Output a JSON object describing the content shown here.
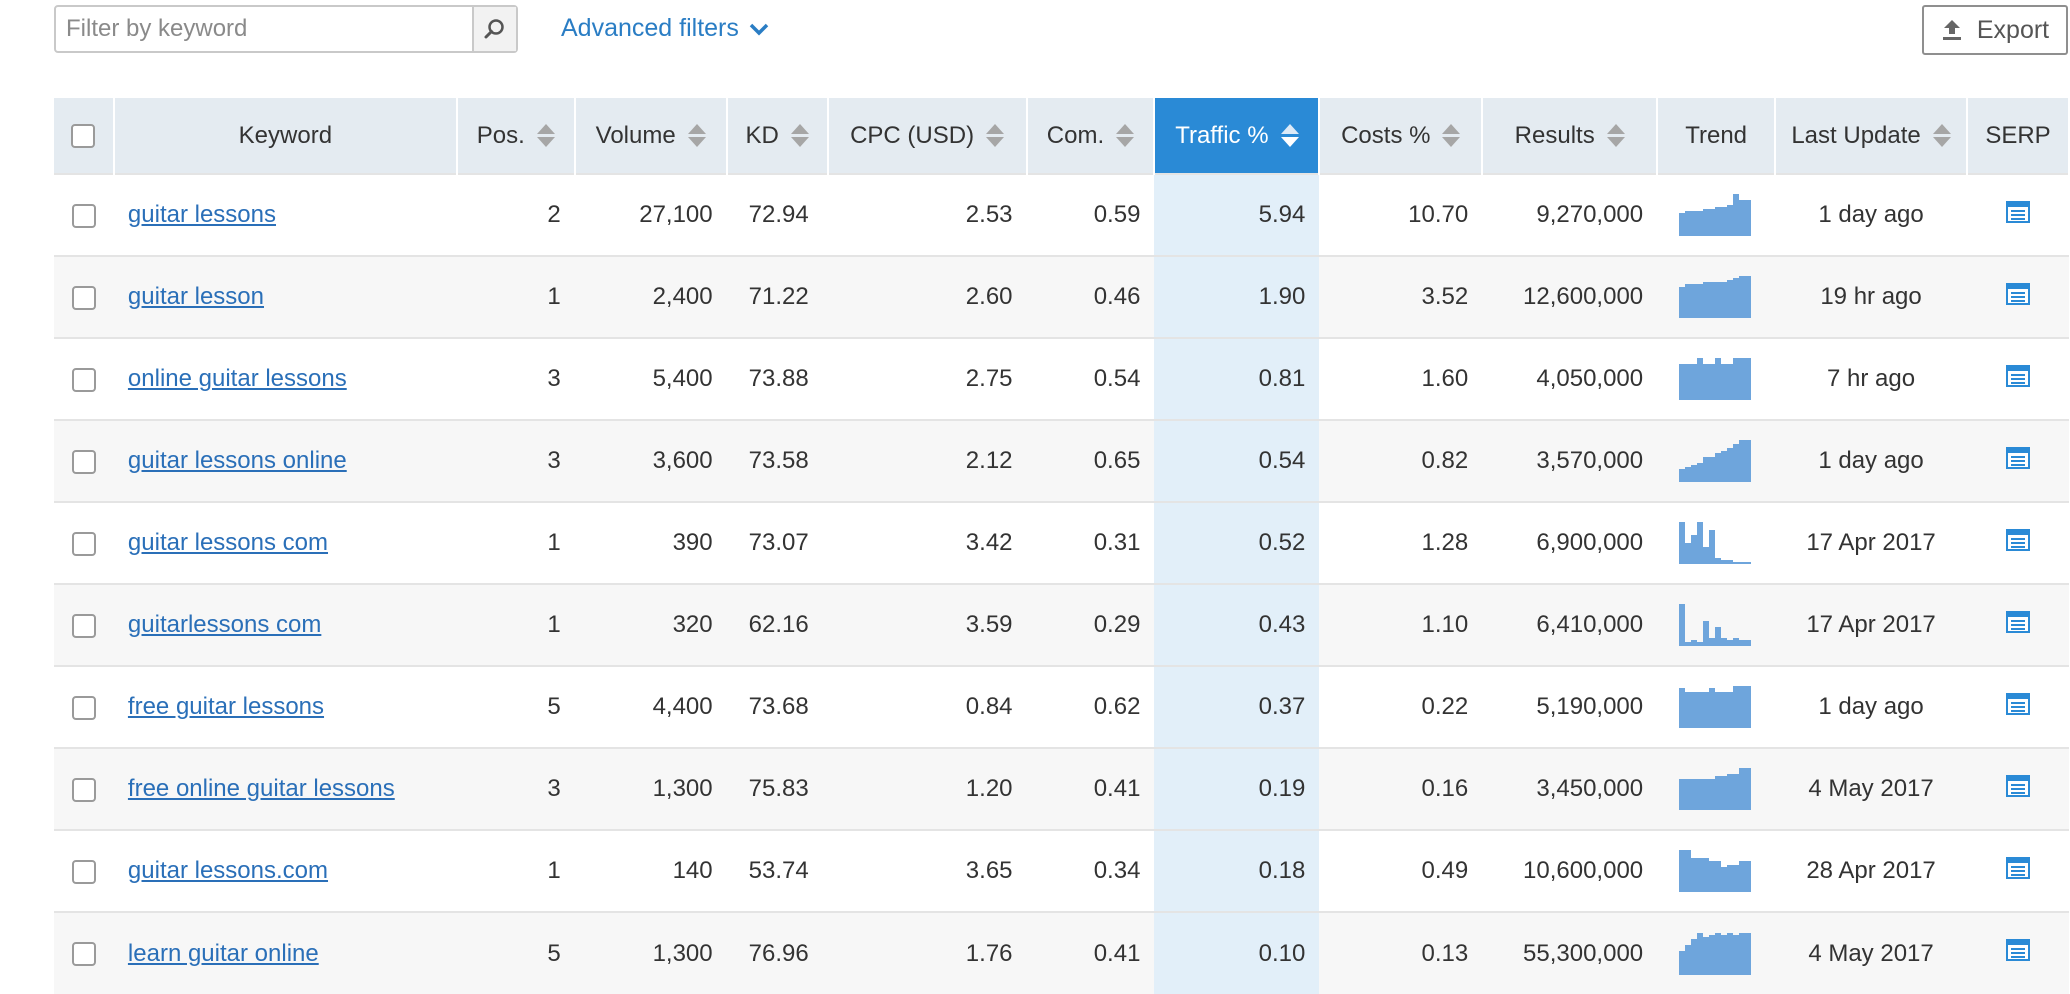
{
  "toolbar": {
    "search_placeholder": "Filter by keyword",
    "advanced_filters_label": "Advanced filters",
    "export_label": "Export"
  },
  "columns": {
    "keyword": "Keyword",
    "pos": "Pos.",
    "volume": "Volume",
    "kd": "KD",
    "cpc": "CPC (USD)",
    "com": "Com.",
    "traffic": "Traffic %",
    "costs": "Costs %",
    "results": "Results",
    "trend": "Trend",
    "last_update": "Last Update",
    "serp": "SERP"
  },
  "colors": {
    "accent": "#2a8ad6",
    "link": "#2a6fb8",
    "header_bg": "#e4ebf1",
    "active_column_bg": "#e2eff9",
    "trend_bar": "#6ea5dc"
  },
  "icons": {
    "search": "magnifier-icon",
    "advanced_filters": "chevron-down-icon",
    "export": "upload-arrow-icon",
    "serp": "serp-list-icon"
  },
  "rows": [
    {
      "keyword": "guitar lessons",
      "pos": "2",
      "volume": "27,100",
      "kd": "72.94",
      "cpc": "2.53",
      "com": "0.59",
      "traffic": "5.94",
      "costs": "10.70",
      "results": "9,270,000",
      "trend": [
        0.55,
        0.6,
        0.6,
        0.6,
        0.65,
        0.65,
        0.7,
        0.7,
        0.75,
        1.0,
        0.85,
        0.85
      ],
      "last_update": "1 day ago"
    },
    {
      "keyword": "guitar lesson",
      "pos": "1",
      "volume": "2,400",
      "kd": "71.22",
      "cpc": "2.60",
      "com": "0.46",
      "traffic": "1.90",
      "costs": "3.52",
      "results": "12,600,000",
      "trend": [
        0.75,
        0.8,
        0.8,
        0.8,
        0.85,
        0.85,
        0.85,
        0.85,
        0.9,
        0.95,
        1.0,
        1.0
      ],
      "last_update": "19 hr ago"
    },
    {
      "keyword": "online guitar lessons",
      "pos": "3",
      "volume": "5,400",
      "kd": "73.88",
      "cpc": "2.75",
      "com": "0.54",
      "traffic": "0.81",
      "costs": "1.60",
      "results": "4,050,000",
      "trend": [
        0.85,
        0.85,
        0.85,
        1.0,
        0.85,
        0.85,
        1.0,
        0.85,
        0.85,
        1.0,
        1.0,
        1.0
      ],
      "last_update": "7 hr ago"
    },
    {
      "keyword": "guitar lessons online",
      "pos": "3",
      "volume": "3,600",
      "kd": "73.58",
      "cpc": "2.12",
      "com": "0.65",
      "traffic": "0.54",
      "costs": "0.82",
      "results": "3,570,000",
      "trend": [
        0.3,
        0.35,
        0.4,
        0.45,
        0.6,
        0.6,
        0.7,
        0.75,
        0.8,
        0.9,
        1.0,
        1.0
      ],
      "last_update": "1 day ago"
    },
    {
      "keyword": "guitar lessons com",
      "pos": "1",
      "volume": "390",
      "kd": "73.07",
      "cpc": "3.42",
      "com": "0.31",
      "traffic": "0.52",
      "costs": "1.28",
      "results": "6,900,000",
      "trend": [
        1.0,
        0.5,
        0.7,
        1.0,
        0.4,
        0.8,
        0.15,
        0.1,
        0.1,
        0.05,
        0.05,
        0.05
      ],
      "last_update": "17 Apr 2017"
    },
    {
      "keyword": "guitarlessons com",
      "pos": "1",
      "volume": "320",
      "kd": "62.16",
      "cpc": "3.59",
      "com": "0.29",
      "traffic": "0.43",
      "costs": "1.10",
      "results": "6,410,000",
      "trend": [
        1.0,
        0.1,
        0.15,
        0.1,
        0.6,
        0.2,
        0.45,
        0.2,
        0.15,
        0.2,
        0.15,
        0.15
      ],
      "last_update": "17 Apr 2017"
    },
    {
      "keyword": "free guitar lessons",
      "pos": "5",
      "volume": "4,400",
      "kd": "73.68",
      "cpc": "0.84",
      "com": "0.62",
      "traffic": "0.37",
      "costs": "0.22",
      "results": "5,190,000",
      "trend": [
        0.95,
        0.85,
        0.85,
        0.85,
        0.85,
        0.95,
        0.85,
        0.85,
        0.85,
        1.0,
        1.0,
        1.0
      ],
      "last_update": "1 day ago"
    },
    {
      "keyword": "free online guitar lessons",
      "pos": "3",
      "volume": "1,300",
      "kd": "75.83",
      "cpc": "1.20",
      "com": "0.41",
      "traffic": "0.19",
      "costs": "0.16",
      "results": "3,450,000",
      "trend": [
        0.75,
        0.75,
        0.75,
        0.75,
        0.75,
        0.75,
        0.8,
        0.8,
        0.85,
        0.85,
        1.0,
        1.0
      ],
      "last_update": "4 May 2017"
    },
    {
      "keyword": "guitar lessons.com",
      "pos": "1",
      "volume": "140",
      "kd": "53.74",
      "cpc": "3.65",
      "com": "0.34",
      "traffic": "0.18",
      "costs": "0.49",
      "results": "10,600,000",
      "trend": [
        1.0,
        1.0,
        0.8,
        0.8,
        0.8,
        0.75,
        0.75,
        0.6,
        0.65,
        0.65,
        0.75,
        0.75
      ],
      "last_update": "28 Apr 2017"
    },
    {
      "keyword": "learn guitar online",
      "pos": "5",
      "volume": "1,300",
      "kd": "76.96",
      "cpc": "1.76",
      "com": "0.41",
      "traffic": "0.10",
      "costs": "0.13",
      "results": "55,300,000",
      "trend": [
        0.55,
        0.7,
        0.85,
        1.0,
        0.9,
        0.95,
        1.0,
        0.95,
        1.0,
        0.95,
        1.0,
        1.0
      ],
      "last_update": "4 May 2017"
    }
  ]
}
